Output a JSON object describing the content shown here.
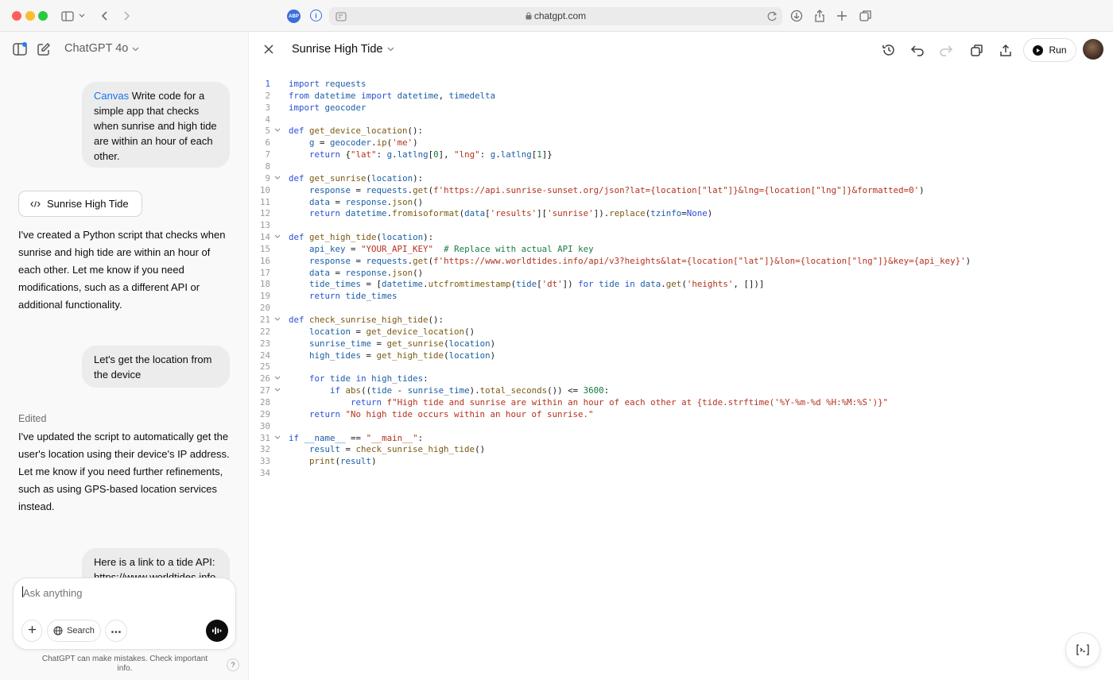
{
  "browser": {
    "url": "chatgpt.com",
    "abp_label": "ABP",
    "traffic_colors": [
      "#ff5f57",
      "#febc2e",
      "#28c840"
    ]
  },
  "sidebar": {
    "model_label": "ChatGPT 4o",
    "messages": [
      {
        "role": "user",
        "prefix": "Canvas",
        "text": " Write code for a simple app that checks when sunrise and high tide are within an hour of each other."
      },
      {
        "role": "canvas_button",
        "label": "Sunrise High Tide"
      },
      {
        "role": "assistant",
        "text": "I've created a Python script that checks when sunrise and high tide are within an hour of each other. Let me know if you need modifications, such as a different API or additional functionality."
      },
      {
        "role": "user",
        "text": "Let's get the location from the device"
      },
      {
        "role": "edited_label",
        "text": "Edited"
      },
      {
        "role": "assistant",
        "text": "I've updated the script to automatically get the user's location using their device's IP address. Let me know if you need further refinements, such as using GPS-based location services instead."
      },
      {
        "role": "user",
        "text": "Here is a link to a tide API: https://www.worldtides.info"
      }
    ],
    "composer": {
      "placeholder": "Ask anything",
      "search_label": "Search"
    },
    "disclaimer": "ChatGPT can make mistakes. Check important info.",
    "help_label": "?"
  },
  "canvas": {
    "title": "Sunrise High Tide",
    "run_label": "Run",
    "code_lines": [
      "import requests",
      "from datetime import datetime, timedelta",
      "import geocoder",
      "",
      "def get_device_location():",
      "    g = geocoder.ip('me')",
      "    return {\"lat\": g.latlng[0], \"lng\": g.latlng[1]}",
      "",
      "def get_sunrise(location):",
      "    response = requests.get(f'https://api.sunrise-sunset.org/json?lat={location[\"lat\"]}&lng={location[\"lng\"]}&formatted=0')",
      "    data = response.json()",
      "    return datetime.fromisoformat(data['results']['sunrise']).replace(tzinfo=None)",
      "",
      "def get_high_tide(location):",
      "    api_key = \"YOUR_API_KEY\"  # Replace with actual API key",
      "    response = requests.get(f'https://www.worldtides.info/api/v3?heights&lat={location[\"lat\"]}&lon={location[\"lng\"]}&key={api_key}')",
      "    data = response.json()",
      "    tide_times = [datetime.utcfromtimestamp(tide['dt']) for tide in data.get('heights', [])]",
      "    return tide_times",
      "",
      "def check_sunrise_high_tide():",
      "    location = get_device_location()",
      "    sunrise_time = get_sunrise(location)",
      "    high_tides = get_high_tide(location)",
      "",
      "    for tide in high_tides:",
      "        if abs((tide - sunrise_time).total_seconds()) <= 3600:",
      "            return f\"High tide and sunrise are within an hour of each other at {tide.strftime('%Y-%m-%d %H:%M:%S')}\"",
      "    return \"No high tide occurs within an hour of sunrise.\"",
      "",
      "if __name__ == \"__main__\":",
      "    result = check_sunrise_high_tide()",
      "    print(result)",
      ""
    ],
    "fold_lines": [
      5,
      9,
      14,
      21,
      26,
      27,
      31
    ],
    "active_line": 1
  }
}
